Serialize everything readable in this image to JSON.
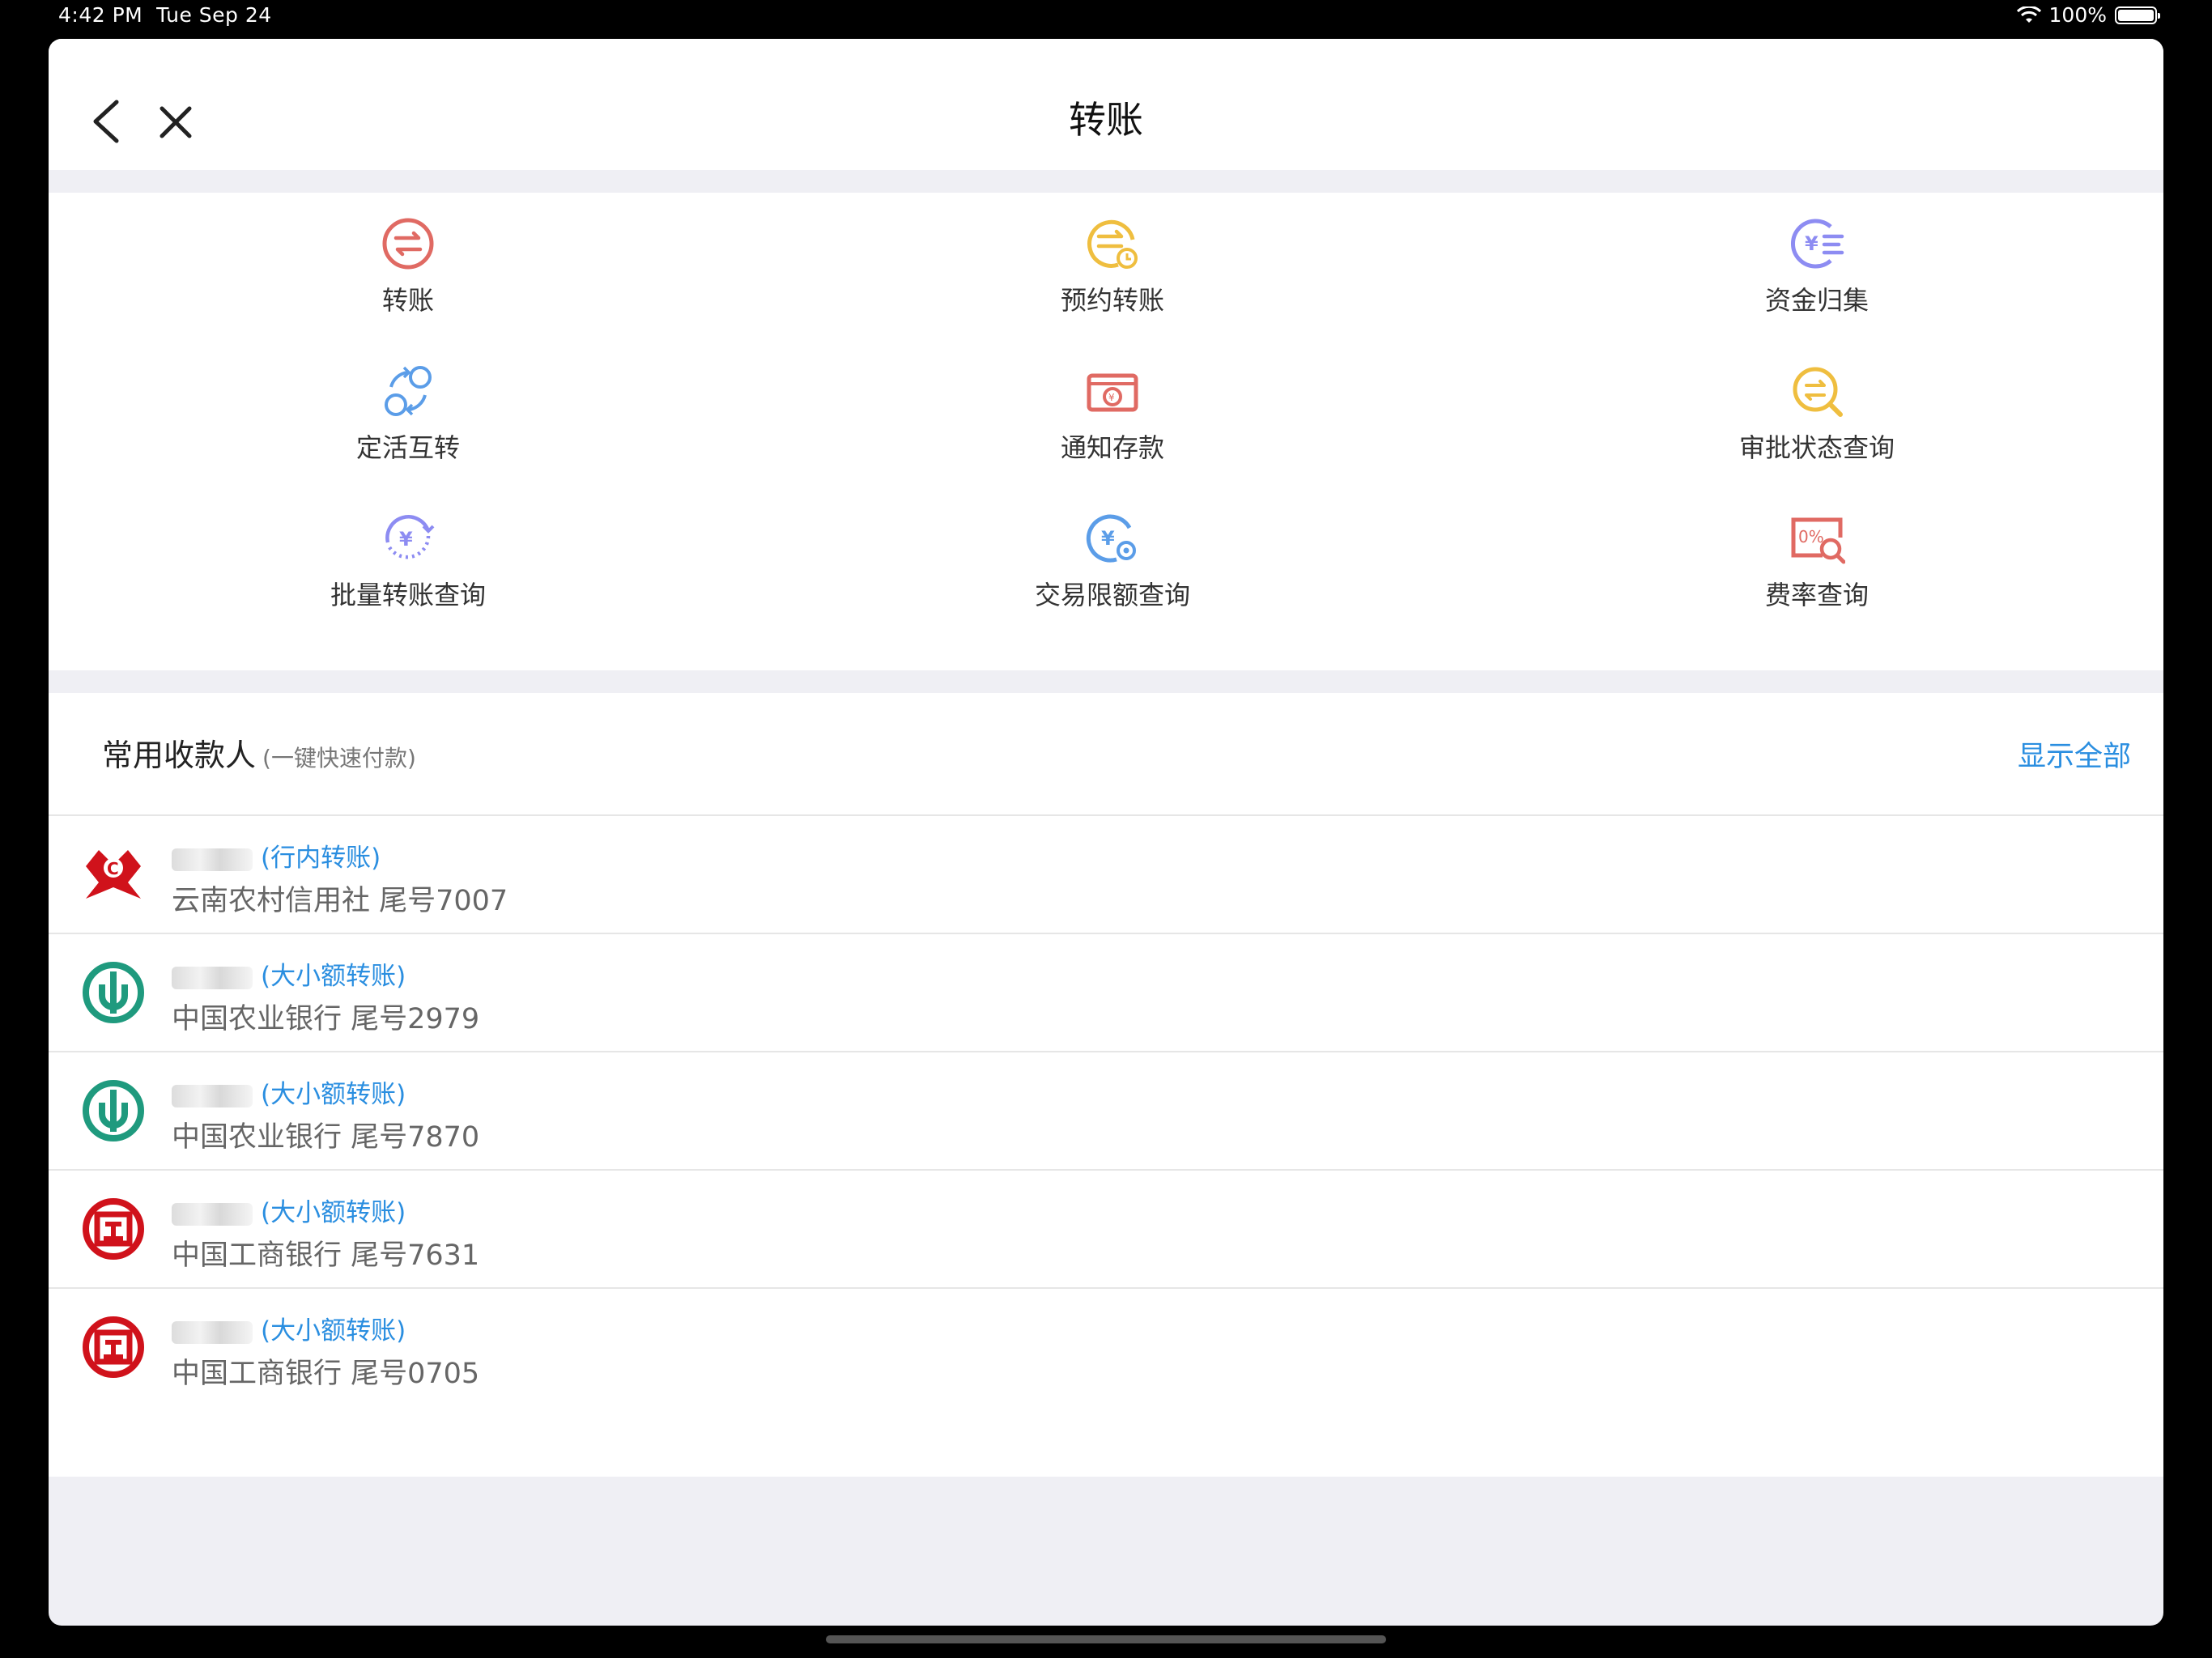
{
  "status": {
    "time": "4:42 PM",
    "date": "Tue Sep 24",
    "battery": "100%"
  },
  "nav": {
    "title": "转账"
  },
  "menu": [
    {
      "label": "转账",
      "icon": "transfer-icon"
    },
    {
      "label": "预约转账",
      "icon": "scheduled-transfer-icon"
    },
    {
      "label": "资金归集",
      "icon": "fund-collection-icon"
    },
    {
      "label": "定活互转",
      "icon": "fixed-current-exchange-icon"
    },
    {
      "label": "通知存款",
      "icon": "notice-deposit-icon"
    },
    {
      "label": "审批状态查询",
      "icon": "approval-status-icon"
    },
    {
      "label": "批量转账查询",
      "icon": "batch-transfer-icon"
    },
    {
      "label": "交易限额查询",
      "icon": "transaction-limit-icon"
    },
    {
      "label": "费率查询",
      "icon": "fee-rate-icon"
    }
  ],
  "payees_section": {
    "title": "常用收款人",
    "subtitle": "(一键快速付款)",
    "show_all": "显示全部"
  },
  "payees": [
    {
      "type": "(行内转账)",
      "bank_info": "云南农村信用社  尾号7007",
      "bank_logo": "rural-credit-logo"
    },
    {
      "type": "(大小额转账)",
      "bank_info": "中国农业银行  尾号2979",
      "bank_logo": "abc-logo"
    },
    {
      "type": "(大小额转账)",
      "bank_info": "中国农业银行  尾号7870",
      "bank_logo": "abc-logo"
    },
    {
      "type": "(大小额转账)",
      "bank_info": "中国工商银行  尾号7631",
      "bank_logo": "icbc-logo"
    },
    {
      "type": "(大小额转账)",
      "bank_info": "中国工商银行  尾号0705",
      "bank_logo": "icbc-logo"
    }
  ],
  "colors": {
    "accent": "#2a8ee0",
    "red": "#e06a63",
    "yellow": "#efbe3f",
    "purple": "#8d8cf2",
    "blue": "#5b9de8",
    "abc_green": "#1f9a7e",
    "icbc_red": "#d0121b"
  }
}
